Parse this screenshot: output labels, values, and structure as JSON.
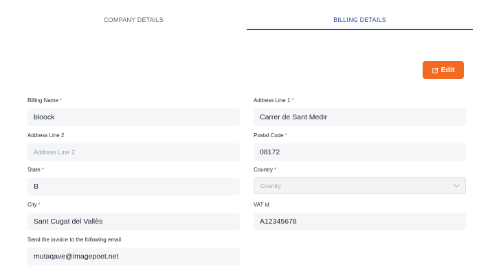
{
  "tabs": {
    "company": "COMPANY DETAILS",
    "billing": "BILLING DETAILS"
  },
  "edit_button": {
    "label": "Edit"
  },
  "form": {
    "billing_name": {
      "label": "Billing Name",
      "value": "bloock",
      "required_mark": "*"
    },
    "address_line_1": {
      "label": "Address Line 1",
      "value": "Carrer de Sant Medir",
      "required_mark": "*"
    },
    "address_line_2": {
      "label": "Address Line 2",
      "placeholder": "Address Line 2"
    },
    "postal_code": {
      "label": "Postal Code",
      "value": "08172",
      "required_mark": "*"
    },
    "state": {
      "label": "State",
      "value": "B",
      "required_mark": "*"
    },
    "country": {
      "label": "Country",
      "placeholder": "Country",
      "required_mark": "*"
    },
    "city": {
      "label": "City",
      "value": "Sant Cugat del Vallès",
      "required_mark": "*"
    },
    "vat_id": {
      "label": "VAT id",
      "value": "A12345678"
    },
    "invoice_email": {
      "label": "Send the invoice to the following email",
      "value": "mutaqave@imagepoet.net"
    }
  },
  "colors": {
    "accent": "#f26a21",
    "active_tab": "#2f4ea3",
    "required": "#e8542a"
  },
  "icons": {
    "edit": "edit-icon",
    "dropdown": "chevron-down-icon"
  }
}
